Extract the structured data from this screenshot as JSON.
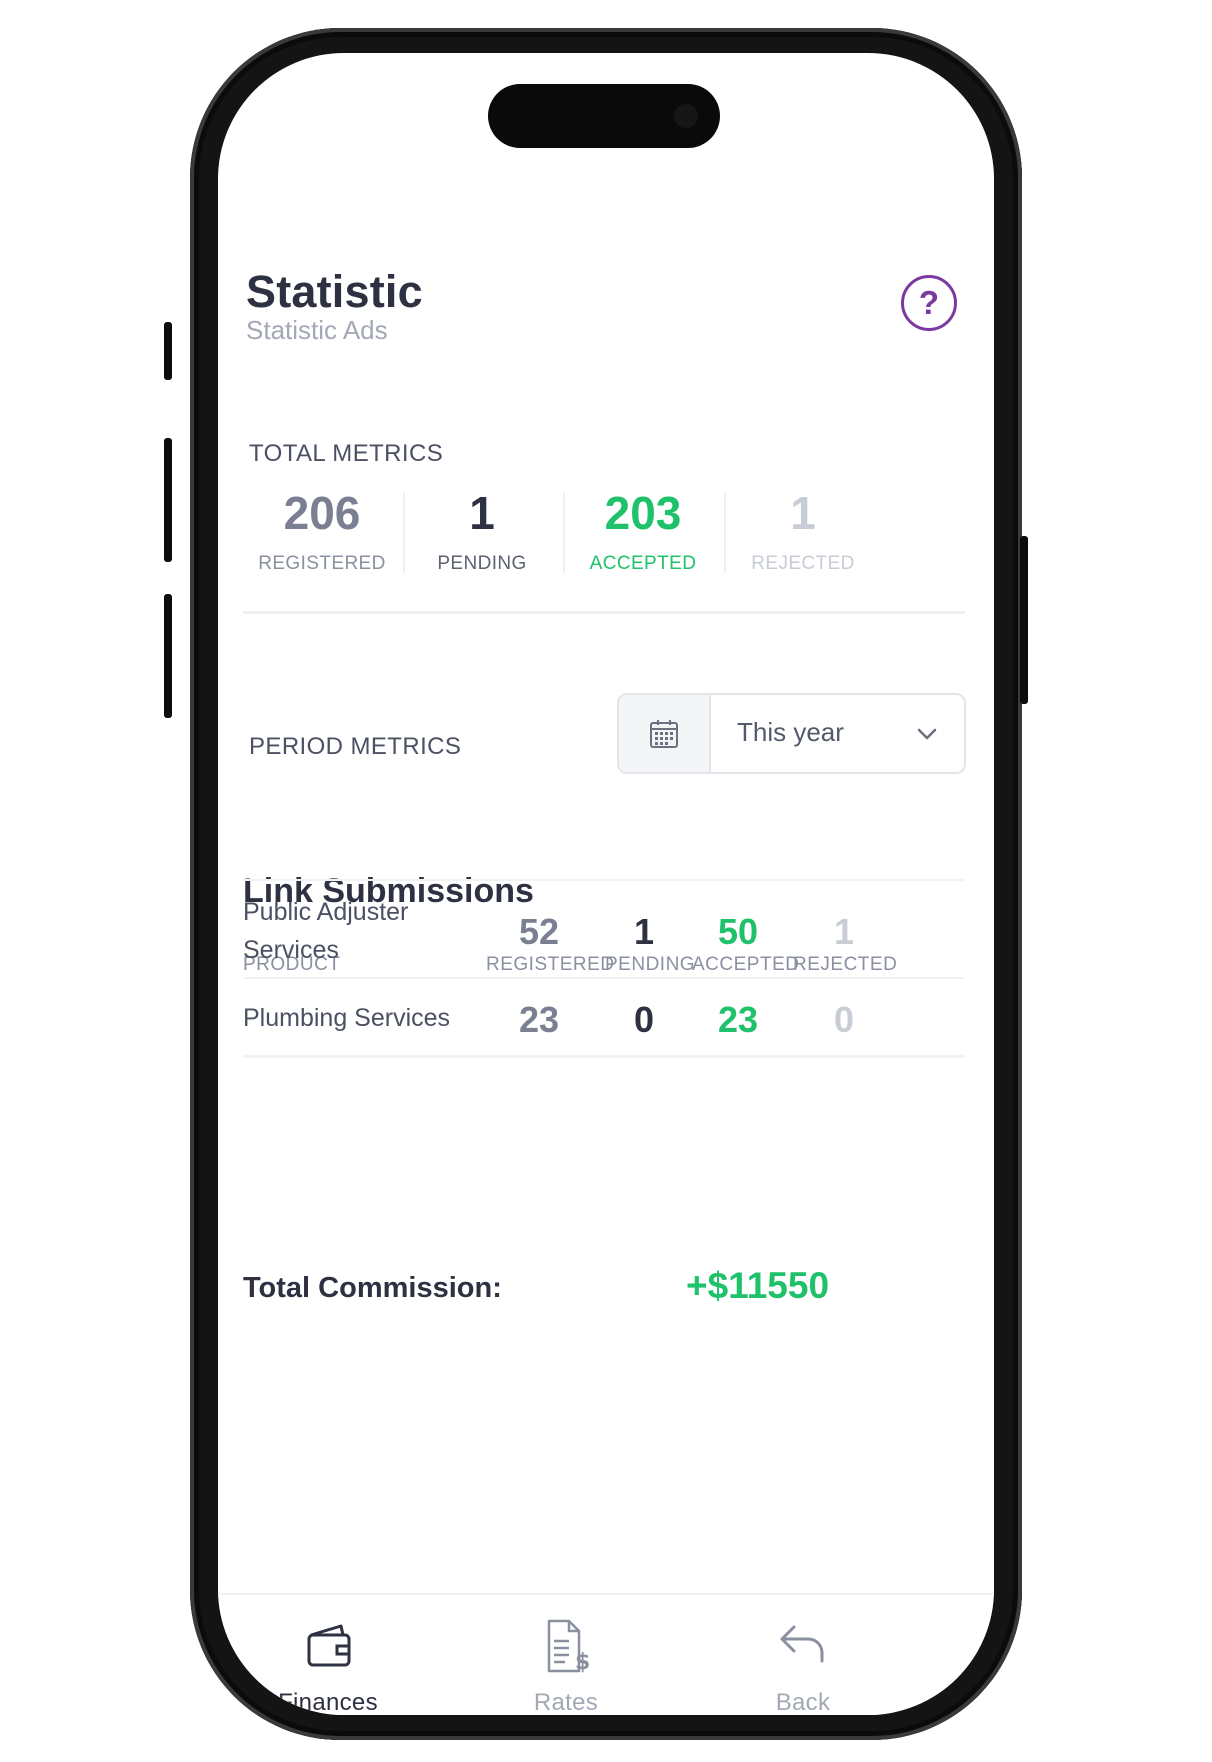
{
  "header": {
    "title": "Statistic",
    "subtitle": "Statistic Ads",
    "help_icon": "question-circle-icon",
    "help_glyph": "?"
  },
  "colors": {
    "primary_text": "#2d3142",
    "accent_purple": "#7a3aa1",
    "accepted_green": "#1fc16b",
    "muted_gray": "#c8ccd5"
  },
  "total_metrics": {
    "label": "TOTAL METRICS",
    "items": [
      {
        "value": "206",
        "label": "REGISTERED"
      },
      {
        "value": "1",
        "label": "PENDING"
      },
      {
        "value": "203",
        "label": "ACCEPTED"
      },
      {
        "value": "1",
        "label": "REJECTED"
      }
    ]
  },
  "period_metrics": {
    "label": "PERIOD METRICS",
    "calendar_icon": "calendar-icon",
    "selected": "This year",
    "dropdown_icon": "chevron-down-icon"
  },
  "link_submissions": {
    "title": "Link Submissions",
    "columns": [
      "PRODUCT",
      "REGISTERED",
      "PENDING",
      "ACCEPTED",
      "REJECTED"
    ],
    "rows": [
      {
        "product_line1": "Public Adjuster",
        "product_line2": "Services",
        "registered": "52",
        "pending": "1",
        "accepted": "50",
        "rejected": "1"
      },
      {
        "product_line1": "Plumbing Services",
        "product_line2": "",
        "registered": "23",
        "pending": "0",
        "accepted": "23",
        "rejected": "0"
      }
    ],
    "total_label": "Total Commission:",
    "total_value": "+$11550"
  },
  "nav": {
    "items": [
      {
        "label": "Finances",
        "icon": "wallet-icon",
        "active": true
      },
      {
        "label": "Rates",
        "icon": "invoice-dollar-icon",
        "active": false
      },
      {
        "label": "Back",
        "icon": "back-arrow-icon",
        "active": false
      }
    ]
  }
}
